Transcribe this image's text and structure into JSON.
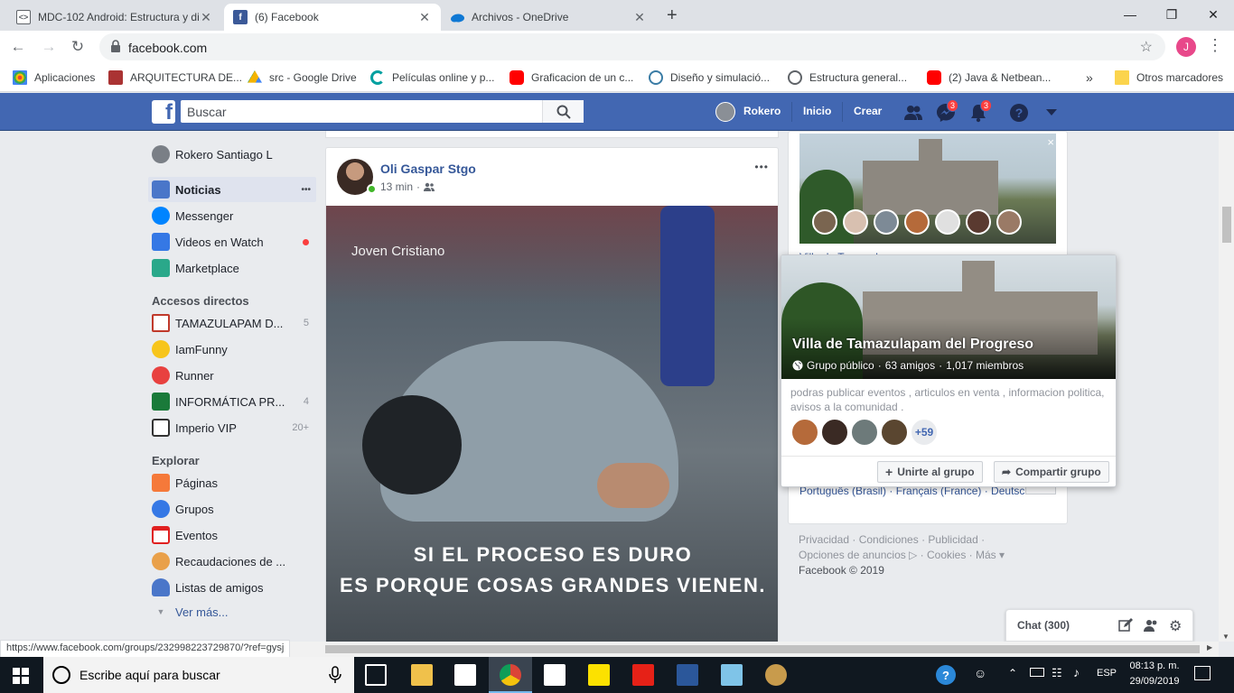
{
  "browser": {
    "tabs": [
      {
        "title": "MDC-102 Android: Estructura y di",
        "active": false
      },
      {
        "title": "(6) Facebook",
        "active": true
      },
      {
        "title": "Archivos - OneDrive",
        "active": false
      }
    ],
    "new_tab": "+",
    "url": "facebook.com",
    "profile_initial": "J",
    "bookmarks": [
      "Aplicaciones",
      "ARQUITECTURA DE...",
      "src - Google Drive",
      "Películas online y p...",
      "Graficacion de un c...",
      "Diseño y simulació...",
      "Estructura general...",
      "(2) Java & Netbean..."
    ],
    "bookmarks_more": "»",
    "other_bookmarks": "Otros marcadores",
    "status_url": "https://www.facebook.com/groups/232998223729870/?ref=gysj"
  },
  "fb": {
    "logo": "f",
    "search_placeholder": "Buscar",
    "user_name": "Rokero",
    "nav_home": "Inicio",
    "nav_create": "Crear",
    "messages_badge": "3",
    "notifications_badge": "3"
  },
  "left": {
    "profile": "Rokero Santiago L",
    "main": [
      {
        "label": "Noticias",
        "more": "•••"
      },
      {
        "label": "Messenger"
      },
      {
        "label": "Videos en Watch"
      },
      {
        "label": "Marketplace"
      }
    ],
    "shortcuts_title": "Accesos directos",
    "shortcuts": [
      {
        "label": "TAMAZULAPAM D...",
        "count": "5"
      },
      {
        "label": "IamFunny",
        "count": ""
      },
      {
        "label": "Runner",
        "count": ""
      },
      {
        "label": "INFORMÁTICA PR...",
        "count": "4"
      },
      {
        "label": "Imperio VIP",
        "count": "20+"
      }
    ],
    "explore_title": "Explorar",
    "explore": [
      {
        "label": "Páginas"
      },
      {
        "label": "Grupos"
      },
      {
        "label": "Eventos"
      },
      {
        "label": "Recaudaciones de ..."
      },
      {
        "label": "Listas de amigos"
      }
    ],
    "see_more": "Ver más..."
  },
  "post": {
    "author": "Oli Gaspar Stgo",
    "time": "13 min",
    "more": "•••",
    "image_brand": "Joven Cristiano",
    "image_line1": "SI EL PROCESO ES DURO",
    "image_line2": "ES PORQUE COSAS GRANDES VIENEN."
  },
  "group_popup": {
    "name": "Villa de Tamazulapam del Progreso",
    "type": "Grupo público",
    "friends": "63 amigos",
    "members": "1,017 miembros",
    "description": "podras publicar eventos , articulos en venta , informacion politica, avisos a la comunidad .",
    "more_members": "+59",
    "join_button": "Unirte al grupo",
    "share_button": "Compartir grupo"
  },
  "right": {
    "close": "×",
    "group_label_fragment": "Villa de Tamazulapam",
    "languages": "Português (Brasil) · Français (France) · Deutsch",
    "footer_line1": "Privacidad · Condiciones · Publicidad ·",
    "footer_line2": "Opciones de anuncios ▷ · Cookies · Más ▾",
    "footer_copyright": "Facebook © 2019"
  },
  "chat": {
    "label": "Chat (300)"
  },
  "taskbar": {
    "search_placeholder": "Escribe aquí para buscar",
    "lang": "ESP",
    "time": "08:13 p. m.",
    "date": "29/09/2019"
  }
}
